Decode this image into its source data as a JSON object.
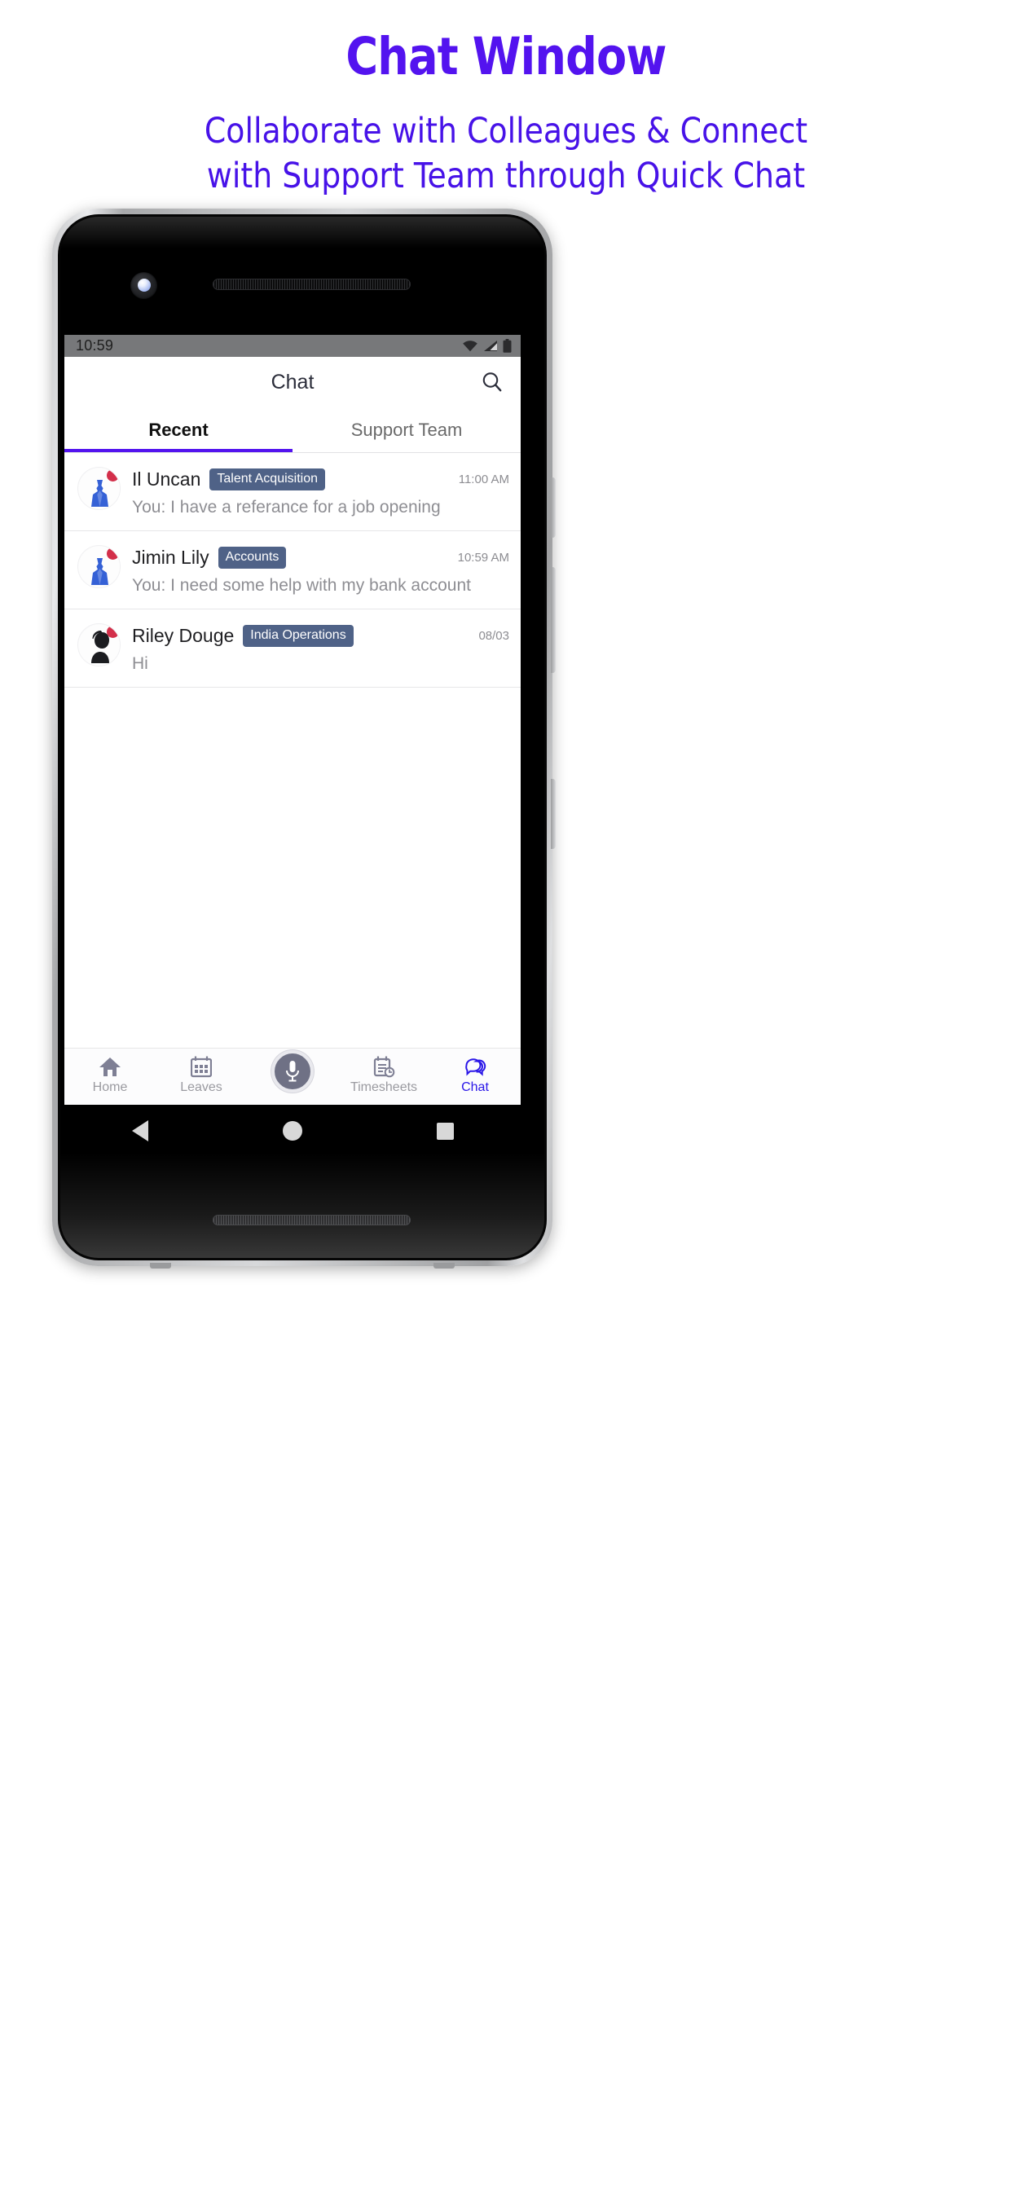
{
  "promo": {
    "title": "Chat Window",
    "subtitle_line1": "Collaborate with Colleagues & Connect",
    "subtitle_line2": "with Support Team through Quick Chat",
    "title_color": "#5313ef",
    "subtitle_color": "#4712e8"
  },
  "statusbar": {
    "time": "10:59",
    "icons": [
      "wifi-icon",
      "signal-icon",
      "battery-icon"
    ],
    "background": "#77787a"
  },
  "appbar": {
    "title": "Chat",
    "search_icon": "search-icon"
  },
  "tabs": [
    {
      "label": "Recent",
      "active": true
    },
    {
      "label": "Support Team",
      "active": false
    }
  ],
  "accent_color": "#5313ef",
  "badge_color": "#4f6287",
  "unread_dot_color": "#d32f4a",
  "chats": [
    {
      "name": "Il Uncan",
      "badge": "Talent Acquisition",
      "time": "11:00 AM",
      "message": "You: I have a referance for a job opening",
      "avatar": "tie-avatar",
      "unread": true
    },
    {
      "name": "Jimin Lily",
      "badge": "Accounts",
      "time": "10:59 AM",
      "message": "You: I need some help with my bank account",
      "avatar": "tie-avatar",
      "unread": true
    },
    {
      "name": "Riley Douge",
      "badge": "India Operations",
      "time": "08/03",
      "message": "Hi",
      "avatar": "person-avatar",
      "unread": true
    }
  ],
  "bottom_nav": [
    {
      "label": "Home",
      "icon": "home-icon",
      "active": false
    },
    {
      "label": "Leaves",
      "icon": "calendar-icon",
      "active": false
    },
    {
      "label": "Timesheets",
      "icon": "timesheet-icon",
      "active": false
    },
    {
      "label": "Chat",
      "icon": "chat-bubbles-icon",
      "active": true
    }
  ],
  "mic_button": {
    "icon": "microphone-icon"
  },
  "android_nav": [
    "back-button",
    "home-button",
    "recents-button"
  ]
}
